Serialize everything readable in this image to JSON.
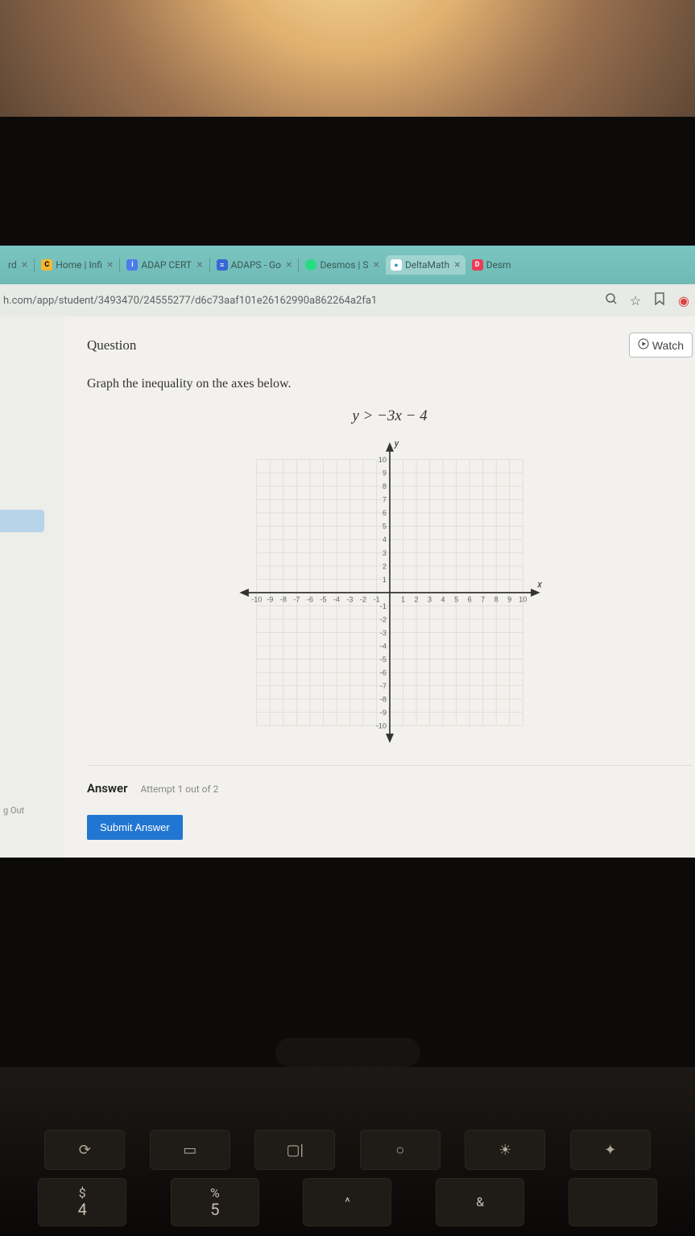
{
  "browser": {
    "tabs": [
      {
        "label": "rd",
        "closable": true
      },
      {
        "label": "Home | Infi",
        "favicon": "C",
        "closable": true
      },
      {
        "label": "ADAP CERT",
        "favicon": "i",
        "closable": true
      },
      {
        "label": "ADAPS - Go",
        "favicon": "≡",
        "closable": true
      },
      {
        "label": "Desmos | S",
        "favicon": "d",
        "closable": true
      },
      {
        "label": "DeltaMath",
        "favicon": "●",
        "active": true,
        "closable": true
      },
      {
        "label": "Desm",
        "favicon": "D"
      }
    ],
    "url": "h.com/app/student/3493470/24555277/d6c73aaf101e26162990a862264a2fa1"
  },
  "sidebar": {
    "logout": "g Out"
  },
  "question": {
    "heading": "Question",
    "watch": "Watch",
    "prompt": "Graph the inequality on the axes below.",
    "equation": "y > −3x − 4"
  },
  "graph": {
    "xlabel": "x",
    "ylabel": "y",
    "xmin": -10,
    "xmax": 10,
    "ymin": -10,
    "ymax": 10,
    "step": 1
  },
  "answer": {
    "label": "Answer",
    "attempt": "Attempt 1 out of 2",
    "submit": "Submit Answer"
  },
  "keyboard": {
    "media": [
      "⟳",
      "▭",
      "▢|",
      "○",
      "☀",
      "✦"
    ],
    "row": [
      {
        "sym": "$",
        "num": "4"
      },
      {
        "sym": "%",
        "num": "5"
      },
      {
        "sym": "^",
        "num": ""
      },
      {
        "sym": "&",
        "num": ""
      },
      {
        "sym": "",
        "num": ""
      }
    ]
  }
}
